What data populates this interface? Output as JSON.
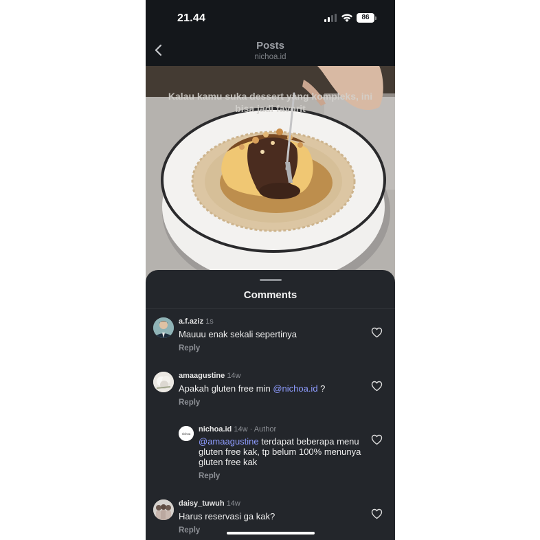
{
  "status_bar": {
    "time": "21.44",
    "battery": "86"
  },
  "header": {
    "title": "Posts",
    "subtitle": "nichoa.id"
  },
  "media": {
    "caption": "Kalau kamu suka dessert yang kompleks, ini bisa jadi favorit"
  },
  "comments_sheet": {
    "title": "Comments",
    "comments": [
      {
        "username": "a.f.aziz",
        "time": "1s",
        "text": "Mauuu enak sekali sepertinya",
        "reply_label": "Reply"
      },
      {
        "username": "amaagustine",
        "time": "14w",
        "text_before": "Apakah gluten free min ",
        "mention": "@nichoa.id",
        "text_after": " ?",
        "reply_label": "Reply"
      },
      {
        "username": "nichoa.id",
        "time": "14w",
        "author_label": "· Author",
        "mention": "@amaagustine",
        "text_after": " terdapat beberapa menu gluten free kak, tp belum 100% menunya gluten free kak",
        "reply_label": "Reply",
        "avatar_text": "nichoa"
      },
      {
        "username": "daisy_tuwuh",
        "time": "14w",
        "text": "Harus reservasi ga kak?",
        "reply_label": "Reply"
      }
    ]
  },
  "colors": {
    "background": "#14171b",
    "sheet": "#23262b",
    "mention": "#8e9cff"
  },
  "icons": [
    "back-chevron-icon",
    "cellular-signal-icon",
    "wifi-icon",
    "battery-icon",
    "heart-icon"
  ]
}
